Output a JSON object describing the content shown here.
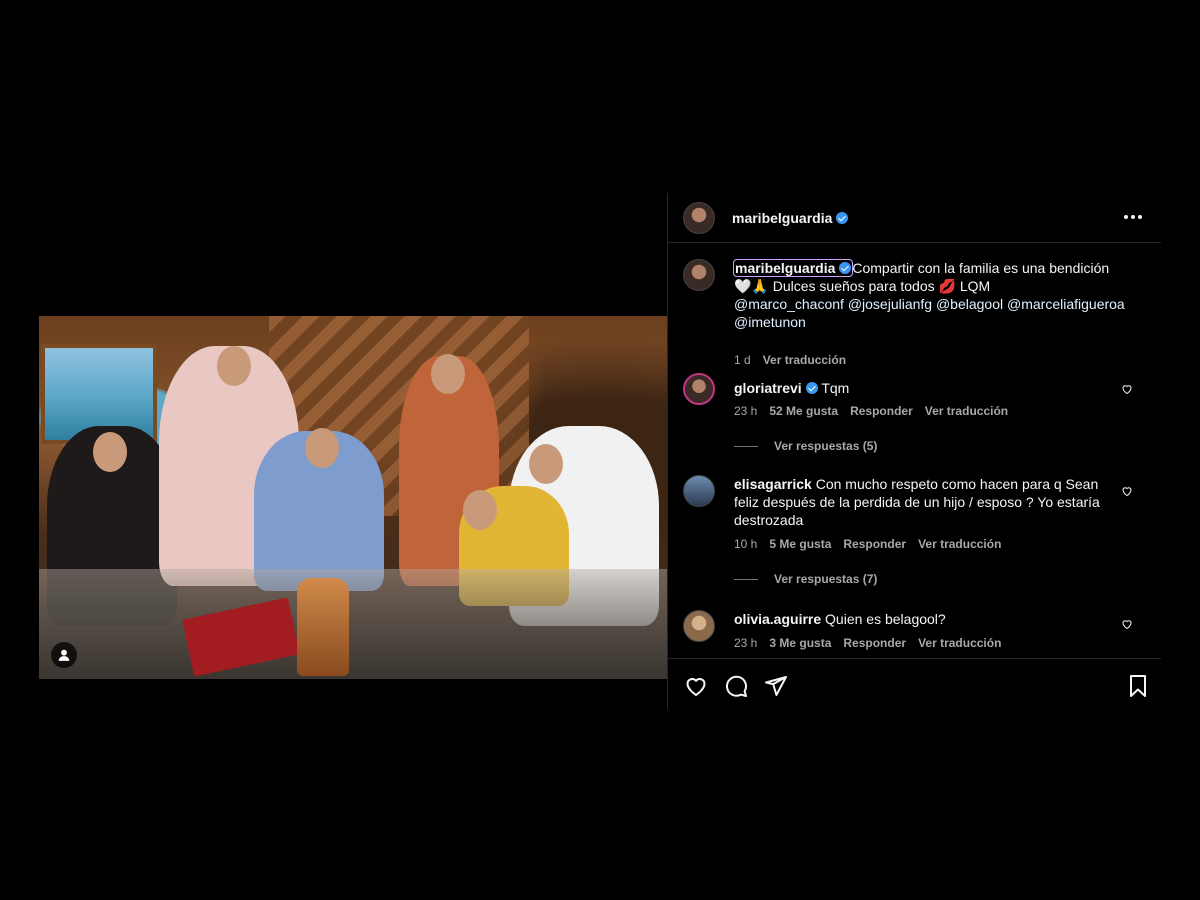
{
  "post": {
    "author": "maribelguardia",
    "caption_author": "maribelguardia",
    "caption_lines": [
      "Compartir con la familia es una bendición",
      "🤍🙏 Dulces sueños para todos 💋 LQM",
      "@marco_chaconf @josejulianfg @belagool @marceliafigueroa",
      "@imetunon"
    ],
    "time": "1 d",
    "translate": "Ver traducción"
  },
  "comments": [
    {
      "user": "gloriatrevi",
      "verified": true,
      "text": "Tqm",
      "time": "23 h",
      "likes": "52 Me gusta",
      "reply": "Responder",
      "translate": "Ver traducción",
      "replies": "Ver respuestas (5)"
    },
    {
      "user": "elisagarrick",
      "verified": false,
      "text_lines": [
        "Con mucho respeto como hacen para q Sean",
        "feliz después de la perdida de un hijo / esposo ? Yo estaría",
        "destrozada"
      ],
      "time": "10 h",
      "likes": "5 Me gusta",
      "reply": "Responder",
      "translate": "Ver traducción",
      "replies": "Ver respuestas (7)"
    },
    {
      "user": "olivia.aguirre",
      "verified": false,
      "text": "Quien es belagool?",
      "time": "23 h",
      "likes": "3 Me gusta",
      "reply": "Responder",
      "translate": "Ver traducción"
    }
  ],
  "icons": [
    "heart-icon",
    "comment-icon",
    "share-icon",
    "bookmark-icon",
    "more-icon",
    "verified-icon",
    "user-tag-icon"
  ],
  "colors": {
    "background": "#000000",
    "text": "#f5f5f5",
    "muted": "#a8a8a8",
    "verified": "#3897f0",
    "divider": "#262626"
  }
}
